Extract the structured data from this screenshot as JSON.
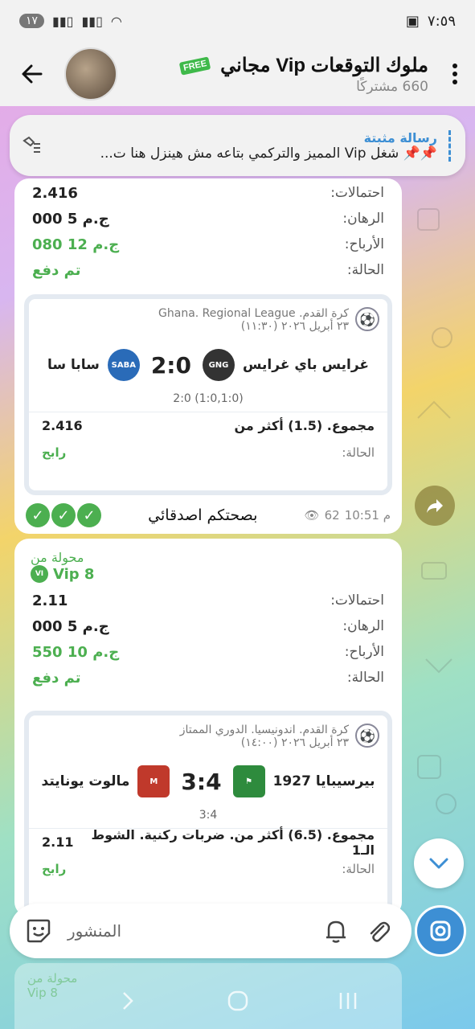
{
  "status_bar": {
    "time": "٧:٥٩",
    "notification_count": "١٧"
  },
  "header": {
    "title": "ملوك التوقعات Vip مجاني",
    "free_badge": "FREE",
    "subscribers": "660 مشتركًا"
  },
  "pinned": {
    "title": "رسالة مثبتة",
    "text": "شغل  Vip المميز والتركمي بتاعه مش هينزل هنا ت..."
  },
  "message1": {
    "rows": [
      {
        "label": "احتمالات:",
        "value": "2.416",
        "green": false
      },
      {
        "label": "الرهان:",
        "value": "ج.م 5 000",
        "green": false
      },
      {
        "label": "الأرباح:",
        "value": "ج.م 12 080",
        "green": true
      },
      {
        "label": "الحالة:",
        "value": "تم دفع",
        "green": true
      }
    ],
    "card": {
      "league": "كرة القدم. Ghana. Regional League",
      "date": "٢٣ أبريل ٢٠٢٦ (١١:٣٠)",
      "home_team": "غرايس باي غرايس",
      "away_team": "سابا سا",
      "score": "2:0",
      "half_scores": "2:0 (1:0,1:0)",
      "bet_text": "مجموع. (1.5) أكثر من",
      "bet_odds": "2.416",
      "status_label": "الحالة:",
      "status_value": "رابح",
      "home_logo": "SABA",
      "away_logo": "GNG"
    },
    "caption": "بصحتكم اصدقائي",
    "views": "62",
    "time": "10:51 م"
  },
  "message2": {
    "forwarded_label": "محولة من",
    "forwarded_source": "Vip 8",
    "vip_badge": "VI",
    "rows": [
      {
        "label": "احتمالات:",
        "value": "2.11",
        "green": false
      },
      {
        "label": "الرهان:",
        "value": "ج.م 5 000",
        "green": false
      },
      {
        "label": "الأرباح:",
        "value": "ج.م 10 550",
        "green": true
      },
      {
        "label": "الحالة:",
        "value": "تم دفع",
        "green": true
      }
    ],
    "card": {
      "league": "كرة القدم. اندونيسيا. الدوري الممتاز",
      "date": "٢٣ أبريل ٢٠٢٦ (١٤:٠٠)",
      "home_team": "بيرسيبايا 1927",
      "away_team": "مالوت يونايتد",
      "score": "3:4",
      "half_scores": "3:4",
      "bet_text": "مجموع. (6.5) أكثر من. ضربات ركنية. الشوط الـ1",
      "bet_odds": "2.11",
      "status_label": "الحالة:",
      "status_value": "رابح"
    }
  },
  "composer": {
    "placeholder": "المنشور"
  },
  "faded_next": {
    "label": "محولة من",
    "source": "Vip 8"
  },
  "colors": {
    "accent": "#3d8fd4",
    "win_green": "#4caf50"
  }
}
